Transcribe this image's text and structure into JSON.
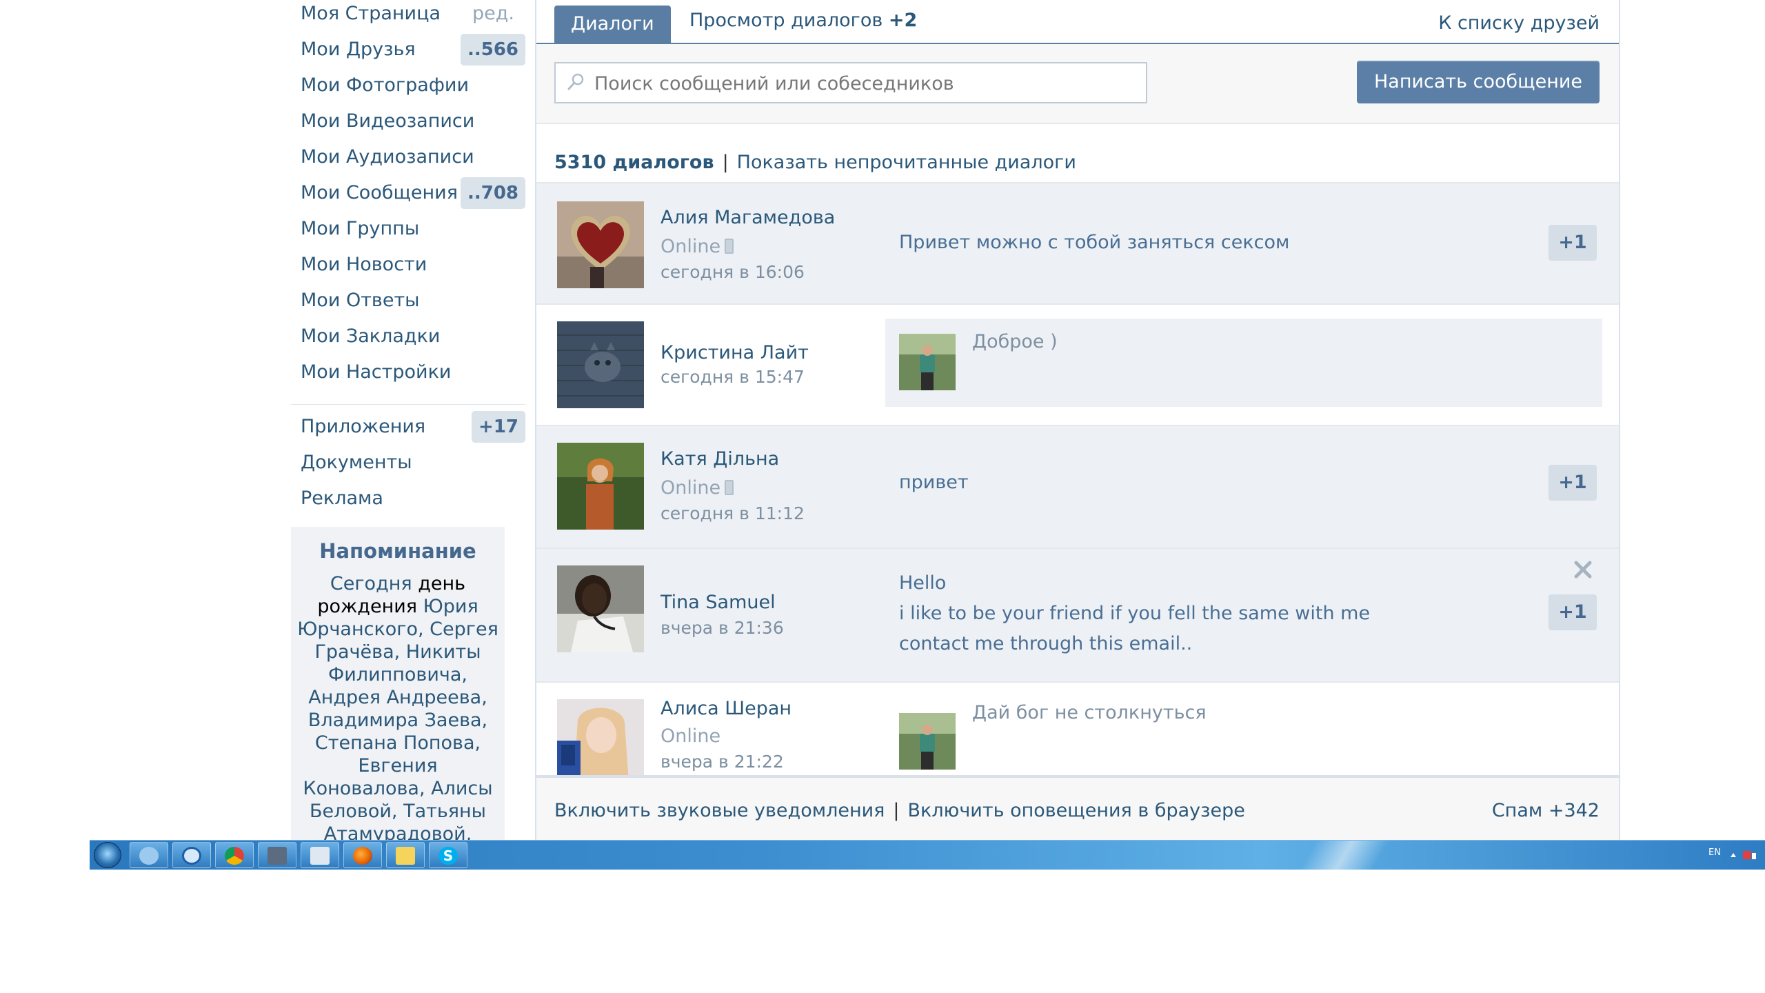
{
  "left_menu": {
    "items": [
      {
        "label": "Моя Страница",
        "extra": "ред."
      },
      {
        "label": "Мои Друзья",
        "badge": "..566"
      },
      {
        "label": "Мои Фотографии"
      },
      {
        "label": "Мои Видеозаписи"
      },
      {
        "label": "Мои Аудиозаписи"
      },
      {
        "label": "Мои Сообщения",
        "badge": "..708"
      },
      {
        "label": "Мои Группы"
      },
      {
        "label": "Мои Новости"
      },
      {
        "label": "Мои Ответы"
      },
      {
        "label": "Мои Закладки"
      },
      {
        "label": "Мои Настройки"
      }
    ],
    "extra_items": [
      {
        "label": "Приложения",
        "badge": "+17"
      },
      {
        "label": "Документы"
      },
      {
        "label": "Реклама"
      }
    ]
  },
  "reminder": {
    "title": "Напоминание",
    "text_1": "Сегодня",
    "text_2": "день рождения",
    "text_3": "Юрия Юрчанского, Сергея Грачёва, Никиты Филипповича, Андрея Андреева, Владимира Заева, Степана Попова, Евгения Коновалова, Алисы Беловой, Татьяны Атамурадовой, Adilet"
  },
  "tabs": {
    "dialogs": "Диалоги",
    "view": "Просмотр диалогов",
    "view_count": "+2",
    "friends_link": "К списку друзей"
  },
  "search": {
    "placeholder": "Поиск сообщений или собеседников"
  },
  "write_button": "Написать сообщение",
  "header": {
    "count": "5310 диалогов",
    "separator": "|",
    "unread_link": "Показать непрочитанные диалоги"
  },
  "dialogs": [
    {
      "name": "Алия Магамедова",
      "status": "Online",
      "time": "сегодня в 16:06",
      "message": "Привет можно с тобой заняться сексом",
      "badge": "+1"
    },
    {
      "name": "Кристина Лайт",
      "time": "сегодня в 15:47",
      "reply": "Доброе )"
    },
    {
      "name": "Катя Дільна",
      "status": "Online",
      "time": "сегодня в 11:12",
      "message": "привет",
      "badge": "+1"
    },
    {
      "name": "Tina Samuel",
      "time": "вчера в 21:36",
      "message": "Hello\ni like to be your friend if you fell the same with me contact me through this email..",
      "badge": "+1"
    },
    {
      "name": "Алиса Шеран",
      "status": "Online",
      "time": "вчера в 21:22",
      "reply": "Дай бог не столкнуться"
    }
  ],
  "footer": {
    "sound": "Включить звуковые уведомления",
    "separator": "|",
    "browser": "Включить оповещения в браузере",
    "spam": "Спам +342"
  },
  "taskbar": {
    "lang": "EN",
    "apps": [
      "ie-icon",
      "media-player-icon",
      "chrome-icon",
      "network-icon",
      "explorer-icon",
      "firefox-icon",
      "folder-icon",
      "skype-icon"
    ]
  },
  "colors": {
    "link": "#2b587a",
    "accent": "#597da3",
    "unread_bg": "#edf1f5",
    "badge_bg": "#d5dde6"
  }
}
